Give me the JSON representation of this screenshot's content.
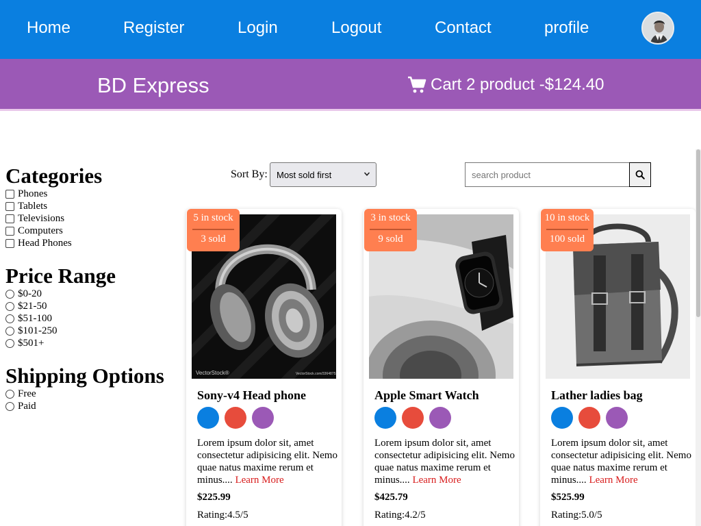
{
  "nav": {
    "items": [
      "Home",
      "Register",
      "Login",
      "Logout",
      "Contact",
      "profile"
    ]
  },
  "brand": {
    "name": "BD Express",
    "cart_text": "Cart 2 product -$124.40",
    "cart_icon": "shopping-cart-icon"
  },
  "sidebar": {
    "categories_heading": "Categories",
    "categories": [
      "Phones",
      "Tablets",
      "Televisions",
      "Computers",
      "Head Phones"
    ],
    "price_heading": "Price Range",
    "price_ranges": [
      "$0-20",
      "$21-50",
      "$51-100",
      "$101-250",
      "$501+"
    ],
    "shipping_heading": "Shipping Options",
    "shipping": [
      "Free",
      "Paid"
    ]
  },
  "toolbar": {
    "sort_label": "Sort By:",
    "sort_value": "Most sold first",
    "search_placeholder": "search product",
    "search_icon": "search-icon"
  },
  "colors": {
    "nav_bg": "#0a7fe0",
    "brand_bg": "#9b59b6",
    "badge_bg": "#ff7f50",
    "swatches": [
      "#0a7fe0",
      "#e74c3c",
      "#9b59b6"
    ],
    "learn_more": "#d81b1b"
  },
  "products": [
    {
      "stock": "5 in stock",
      "sold": "3 sold",
      "name": "Sony-v4 Head phone",
      "desc": "Lorem ipsum dolor sit, amet consectetur adipisicing elit. Nemo quae natus maxime rerum et minus....",
      "learn_more": "Learn More",
      "price": "$225.99",
      "rating": "Rating:4.5/5",
      "watermark": "VectorStock®",
      "watermark_id": "VectorStock.com/33648753"
    },
    {
      "stock": "3 in stock",
      "sold": "9 sold",
      "name": "Apple Smart Watch",
      "desc": "Lorem ipsum dolor sit, amet consectetur adipisicing elit. Nemo quae natus maxime rerum et minus....",
      "learn_more": "Learn More",
      "price": "$425.79",
      "rating": "Rating:4.2/5"
    },
    {
      "stock": "10 in stock",
      "sold": "100 sold",
      "name": "Lather ladies bag",
      "desc": "Lorem ipsum dolor sit, amet consectetur adipisicing elit. Nemo quae natus maxime rerum et minus....",
      "learn_more": "Learn More",
      "price": "$525.99",
      "rating": "Rating:5.0/5"
    }
  ]
}
